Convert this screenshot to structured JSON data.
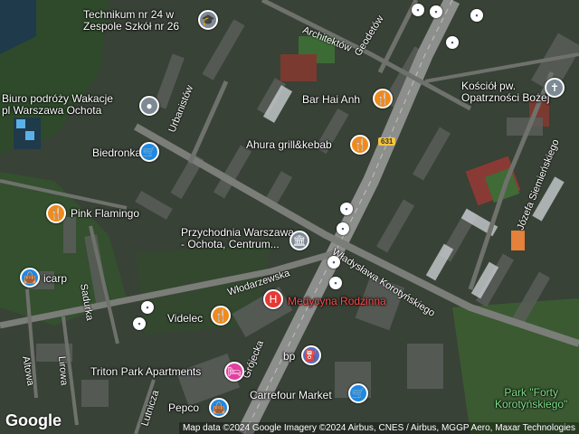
{
  "map": {
    "logo": "Google",
    "attribution": "Map data ©2024 Google Imagery ©2024 Airbus, CNES / Airbus, MGGP Aero, Maxar Technologies",
    "road_shield": "631"
  },
  "places": [
    {
      "key": "technikum",
      "line1": "Technikum nr 24 w",
      "line2": "Zespole Szkół nr 26",
      "icon": "school-icon",
      "color": "#7d8a94"
    },
    {
      "key": "biuro",
      "line1": "Biuro podróży Wakacje",
      "line2": "pl Warszawa Ochota",
      "icon": "location-pin-icon",
      "color": "#7d8a94"
    },
    {
      "key": "bar_hai_anh",
      "line1": "Bar Hai Anh",
      "icon": "restaurant-icon",
      "color": "#f08a1c"
    },
    {
      "key": "ahura",
      "line1": "Ahura grill&kebab",
      "icon": "restaurant-icon",
      "color": "#f08a1c"
    },
    {
      "key": "biedronka",
      "line1": "Biedronka",
      "icon": "shopping-cart-icon",
      "color": "#1e88e5"
    },
    {
      "key": "pink_flamingo",
      "line1": "Pink Flamingo",
      "icon": "restaurant-icon",
      "color": "#f08a1c"
    },
    {
      "key": "przychodnia",
      "line1": "Przychodnia Warszawa",
      "line2": "- Ochota, Centrum...",
      "icon": "clinic-icon",
      "color": "#7d8a94"
    },
    {
      "key": "icarp",
      "line1": "icarp",
      "icon": "shopping-bag-icon",
      "color": "#1e88e5"
    },
    {
      "key": "medycyna",
      "line1": "Medycyna Rodzinna",
      "icon": "hospital-icon",
      "color": "#e53935"
    },
    {
      "key": "videlec",
      "line1": "Videlec",
      "icon": "restaurant-icon",
      "color": "#f08a1c"
    },
    {
      "key": "bp",
      "line1": "bp",
      "icon": "gas-station-icon",
      "color": "#5c6bc0"
    },
    {
      "key": "triton",
      "line1": "Triton Park Apartments",
      "icon": "hotel-icon",
      "color": "#e040a0"
    },
    {
      "key": "pepco",
      "line1": "Pepco",
      "icon": "shopping-bag-icon",
      "color": "#1e88e5"
    },
    {
      "key": "carrefour",
      "line1": "Carrefour Market",
      "icon": "shopping-cart-icon",
      "color": "#1e88e5"
    },
    {
      "key": "kosciol",
      "line1": "Kościół pw.",
      "line2": "Opatrzności Bożej",
      "icon": "church-icon",
      "color": "#7d8a94"
    },
    {
      "key": "park",
      "line1": "Park \"Forty",
      "line2": "Korotyńskiego\"",
      "icon": "",
      "color": ""
    }
  ],
  "streets": {
    "architektow": "Architektów",
    "geodetow": "Geodetów",
    "urbanistow": "Urbanistów",
    "wlodarzewska": "Włodarzewska",
    "korotynskiego": "Władysława Korotyńskiego",
    "siemienskiego": "Józefa Siemieńskiego",
    "sadurka": "Sadurka",
    "altowa": "Altowa",
    "lirowa": "Lirowa",
    "grojecka": "Grójecka",
    "lutnicza": "Lutnicza"
  }
}
